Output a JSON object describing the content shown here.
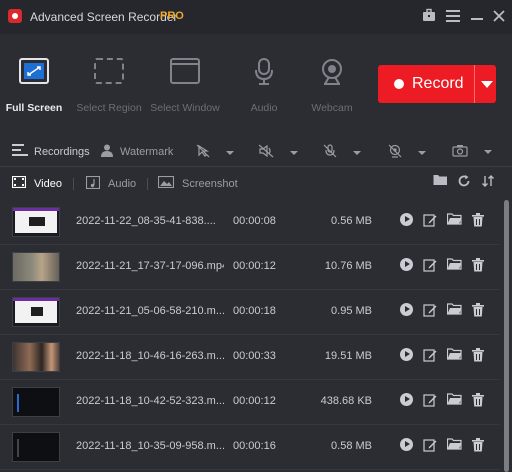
{
  "app": {
    "title": "Advanced Screen Recorder",
    "badge": "PRO"
  },
  "modes": [
    {
      "label": "Full Screen",
      "icon": "fullscreen-icon",
      "active": true
    },
    {
      "label": "Select Region",
      "icon": "select-region-icon",
      "active": false
    },
    {
      "label": "Select Window",
      "icon": "select-window-icon",
      "active": false
    },
    {
      "label": "Audio",
      "icon": "microphone-icon",
      "active": false
    },
    {
      "label": "Webcam",
      "icon": "webcam-icon",
      "active": false
    }
  ],
  "record": {
    "label": "Record",
    "color": "#ed1c24"
  },
  "options": {
    "recordings_label": "Recordings",
    "watermark_label": "Watermark"
  },
  "tabs": [
    {
      "label": "Video",
      "icon": "film-icon",
      "active": true
    },
    {
      "label": "Audio",
      "icon": "music-note-icon",
      "active": false
    },
    {
      "label": "Screenshot",
      "icon": "image-icon",
      "active": false
    }
  ],
  "recordings": [
    {
      "name": "2022-11-22_08-35-41-838....",
      "duration": "00:00:08",
      "size": "0.56 MB",
      "thumb": "white"
    },
    {
      "name": "2022-11-21_17-37-17-096.mp4",
      "duration": "00:00:12",
      "size": "10.76 MB",
      "thumb": "person"
    },
    {
      "name": "2022-11-21_05-06-58-210.m...",
      "duration": "00:00:18",
      "size": "0.95 MB",
      "thumb": "white"
    },
    {
      "name": "2022-11-18_10-46-16-263.m...",
      "duration": "00:00:33",
      "size": "19.51 MB",
      "thumb": "person2"
    },
    {
      "name": "2022-11-18_10-42-52-323.m...",
      "duration": "00:00:12",
      "size": "438.68 KB",
      "thumb": "dark"
    },
    {
      "name": "2022-11-18_10-35-09-958.m...",
      "duration": "00:00:16",
      "size": "0.58 MB",
      "thumb": "dark"
    }
  ]
}
